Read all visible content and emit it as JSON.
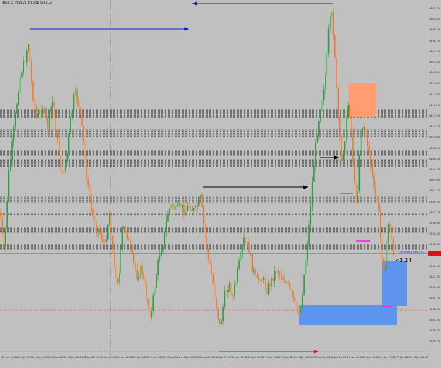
{
  "window": {
    "ohlc_info": "4654.22 4654.24 4583 4b 4593.32",
    "countdown": "<3:24",
    "bid_label": "2.0 4683.3 pips | 34.1",
    "price_ticks": [
      "4633.70",
      "4632.95",
      "4628.20",
      "4626.15",
      "4624.30",
      "4622.55",
      "4620.80",
      "4619.05",
      "4617.00",
      "4615.25",
      "4613.50",
      "4611.75",
      "4610.00",
      "4608.25",
      "4606.50",
      "4604.75",
      "4603.00",
      "4601.25",
      "4599.50",
      "4597.75",
      "4596.00",
      "4594.25",
      "4592.50",
      "4590.75",
      "4589.00",
      "4587.25",
      "4585.50",
      "4583.75",
      "4582.00",
      "4580.25",
      "4578.50",
      "4576.75"
    ],
    "time_ticks": [
      "12 Jan 16:00",
      "12 Jan 17:00",
      "12 Jan 18:00",
      "12 Jan 19:00",
      "12 Jan 20:00",
      "12 Jan 21:00",
      "12 Jan 22:00",
      "13 Jan 01:00",
      "13 Jan 02:00",
      "13 Jan 03:00",
      "13 Jan 04:00",
      "13 Jan 05:00",
      "13 Jan 06:00",
      "13 Jan 07:00",
      "13 Jan 08:00",
      "13 Jan 09:00",
      "13 Jan 10:00",
      "13 Jan 11:00",
      "13 Jan 12:00",
      "13 Jan 13:00",
      "13 Jan 14:00",
      "13 Jan 15:00",
      "13 Jan 16:00",
      "13 Jan 17:00",
      "13 Jan 18:00",
      "13 Jan 19:00"
    ]
  },
  "colors": {
    "background": "#c0c0c0",
    "bull": "#2e9e3e",
    "bear": "#f07a2a",
    "zone_black": "#000000",
    "bid_line": "#e01010",
    "arrow_blue": "#1a1ad8",
    "arrow_black": "#000000",
    "arrow_red": "#e01010",
    "box_orange": "#ff9c70",
    "box_blue": "#5e94ee",
    "marker_magenta": "#ff18d8"
  }
}
